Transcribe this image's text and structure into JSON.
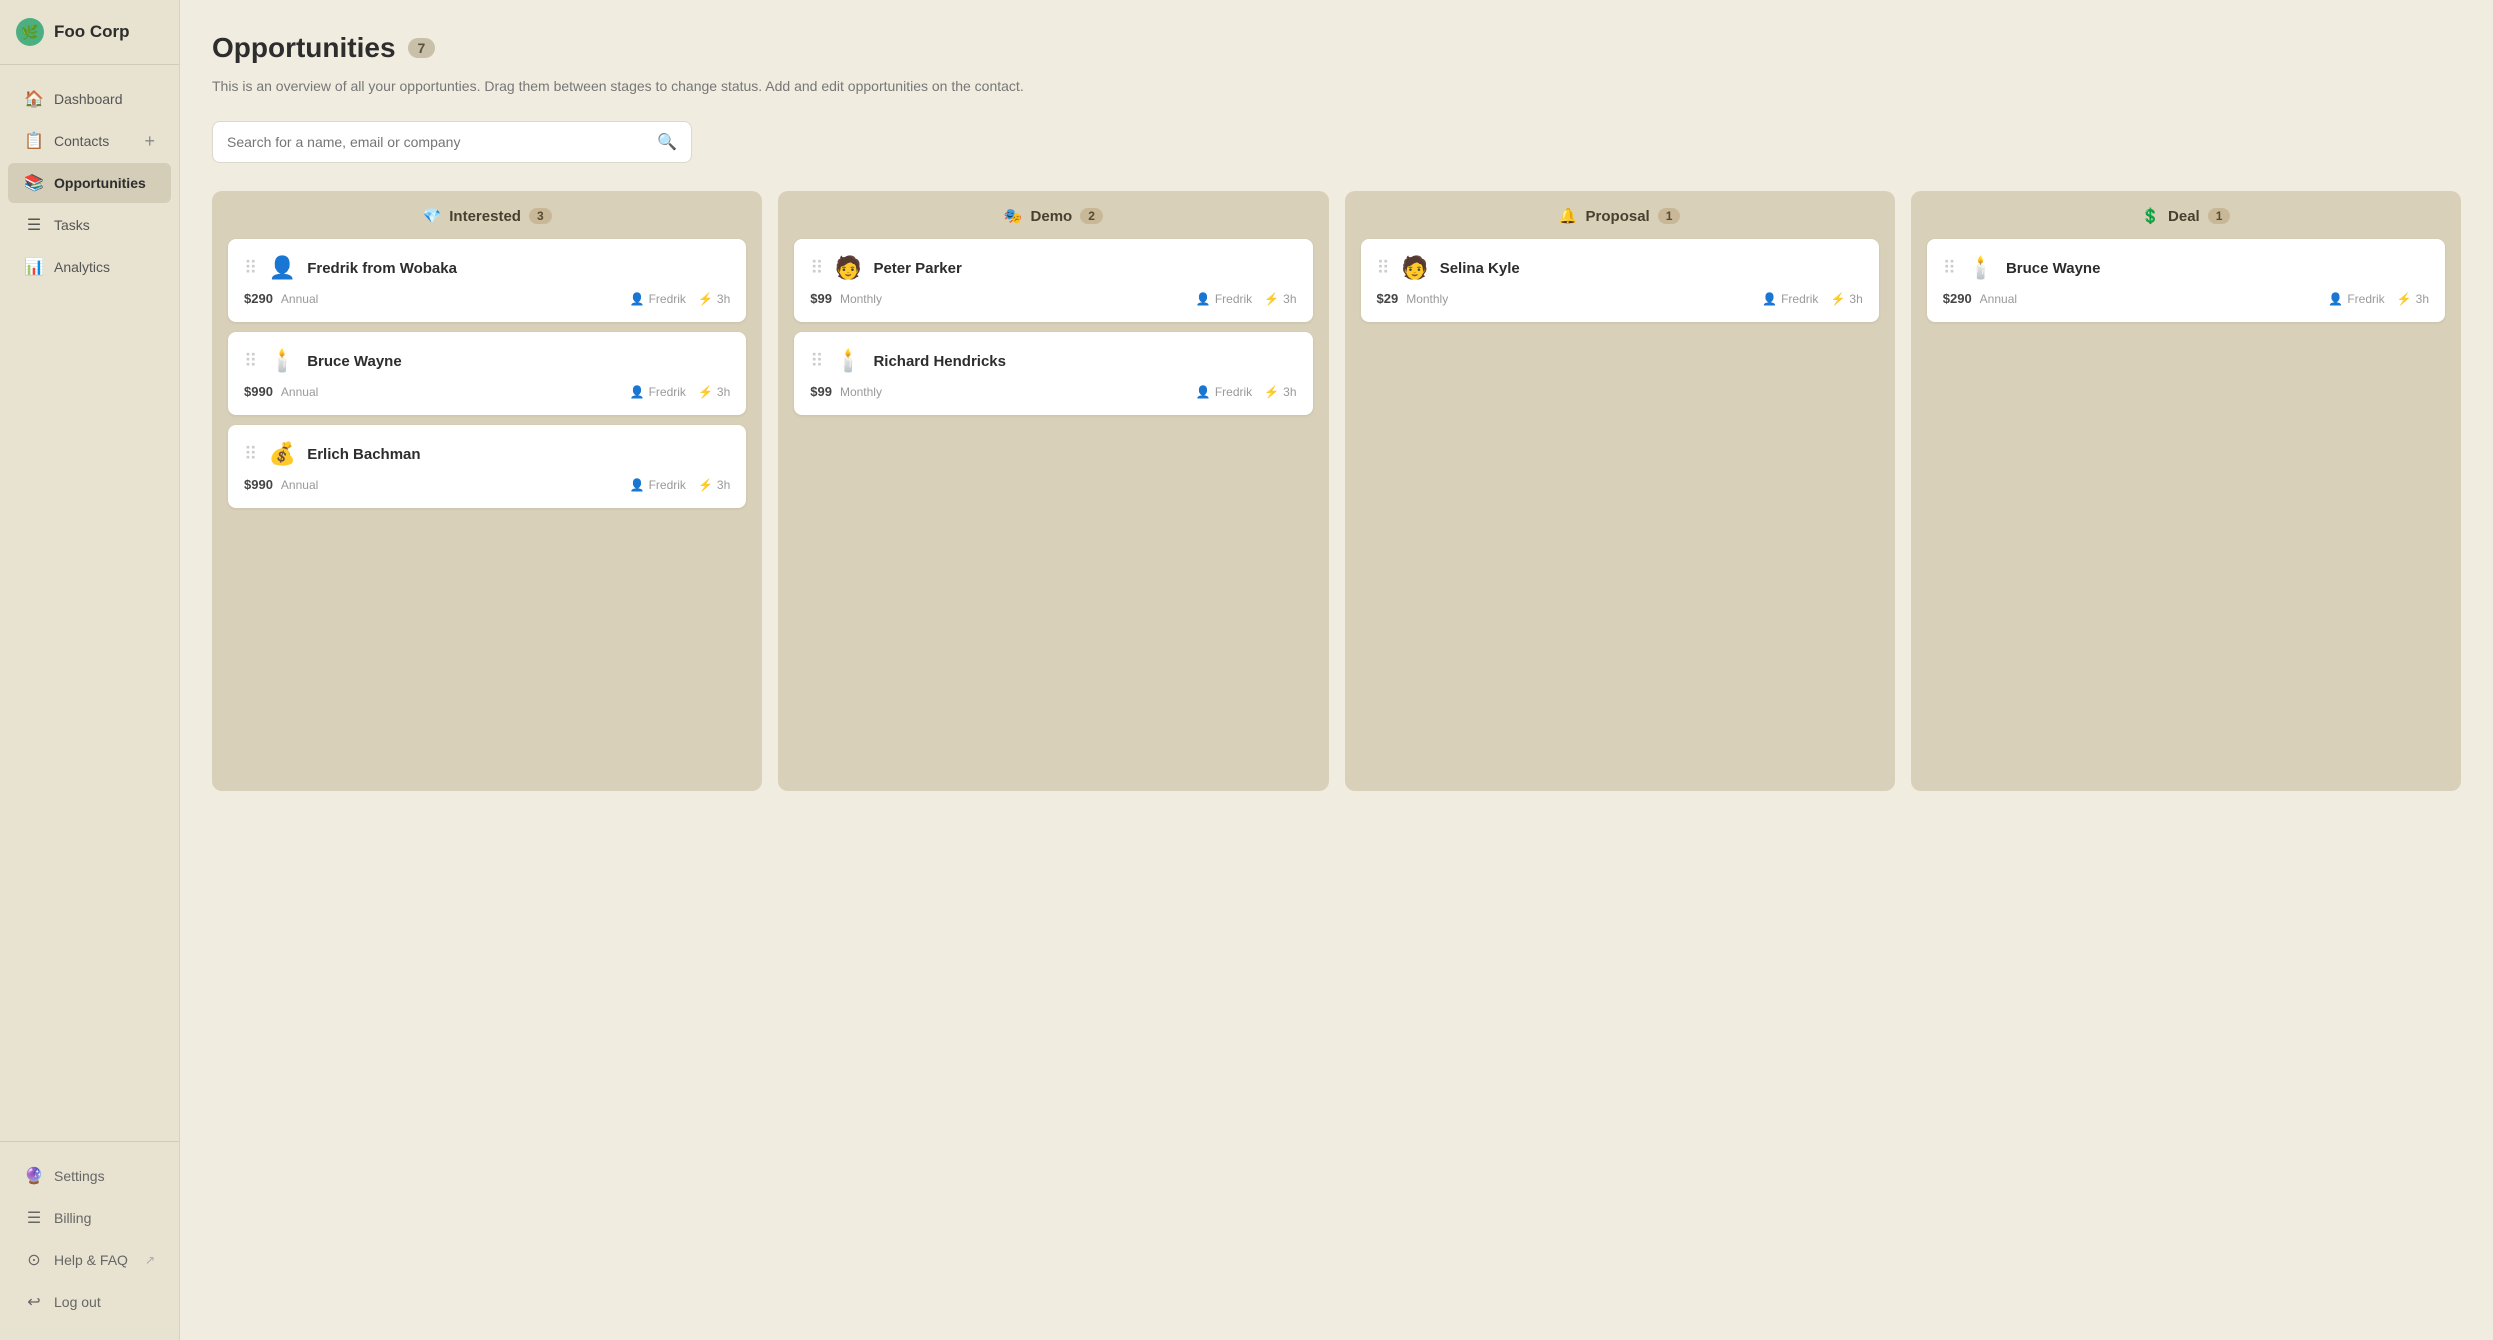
{
  "app": {
    "name": "Foo Corp",
    "logo_icon": "🌿"
  },
  "sidebar": {
    "nav_items": [
      {
        "id": "dashboard",
        "label": "Dashboard",
        "icon": "🏠",
        "active": false
      },
      {
        "id": "contacts",
        "label": "Contacts",
        "icon": "📋",
        "active": false,
        "add": true
      },
      {
        "id": "opportunities",
        "label": "Opportunities",
        "icon": "📚",
        "active": true
      },
      {
        "id": "tasks",
        "label": "Tasks",
        "icon": "☰",
        "active": false
      },
      {
        "id": "analytics",
        "label": "Analytics",
        "icon": "📊",
        "active": false
      }
    ],
    "bottom_items": [
      {
        "id": "settings",
        "label": "Settings",
        "icon": "🔮"
      },
      {
        "id": "billing",
        "label": "Billing",
        "icon": "☰"
      },
      {
        "id": "help",
        "label": "Help & FAQ",
        "icon": "⊙",
        "external": true
      },
      {
        "id": "logout",
        "label": "Log out",
        "icon": "↩"
      }
    ]
  },
  "page": {
    "title": "Opportunities",
    "count": "7",
    "description": "This is an overview of all your opportunties. Drag them between stages to\nchange status. Add and edit opportunities on the contact.",
    "search_placeholder": "Search for a name, email or company"
  },
  "columns": [
    {
      "id": "interested",
      "label": "Interested",
      "icon": "💎",
      "count": "3",
      "cards": [
        {
          "id": "c1",
          "name": "Fredrik from Wobaka",
          "avatar": "👤",
          "amount": "$290",
          "period": "Annual",
          "assignee": "Fredrik",
          "time": "3h"
        },
        {
          "id": "c2",
          "name": "Bruce Wayne",
          "avatar": "🕯️",
          "amount": "$990",
          "period": "Annual",
          "assignee": "Fredrik",
          "time": "3h"
        },
        {
          "id": "c3",
          "name": "Erlich Bachman",
          "avatar": "💰",
          "amount": "$990",
          "period": "Annual",
          "assignee": "Fredrik",
          "time": "3h"
        }
      ]
    },
    {
      "id": "demo",
      "label": "Demo",
      "icon": "🎭",
      "count": "2",
      "cards": [
        {
          "id": "c4",
          "name": "Peter Parker",
          "avatar": "🧑",
          "amount": "$99",
          "period": "Monthly",
          "assignee": "Fredrik",
          "time": "3h"
        },
        {
          "id": "c5",
          "name": "Richard Hendricks",
          "avatar": "🕯️",
          "amount": "$99",
          "period": "Monthly",
          "assignee": "Fredrik",
          "time": "3h"
        }
      ]
    },
    {
      "id": "proposal",
      "label": "Proposal",
      "icon": "🔔",
      "count": "1",
      "cards": [
        {
          "id": "c6",
          "name": "Selina Kyle",
          "avatar": "🧑",
          "amount": "$29",
          "period": "Monthly",
          "assignee": "Fredrik",
          "time": "3h"
        }
      ]
    },
    {
      "id": "deal",
      "label": "Deal",
      "icon": "💲",
      "count": "1",
      "cards": [
        {
          "id": "c7",
          "name": "Bruce Wayne",
          "avatar": "🕯️",
          "amount": "$290",
          "period": "Annual",
          "assignee": "Fredrik",
          "time": "3h"
        }
      ]
    }
  ]
}
